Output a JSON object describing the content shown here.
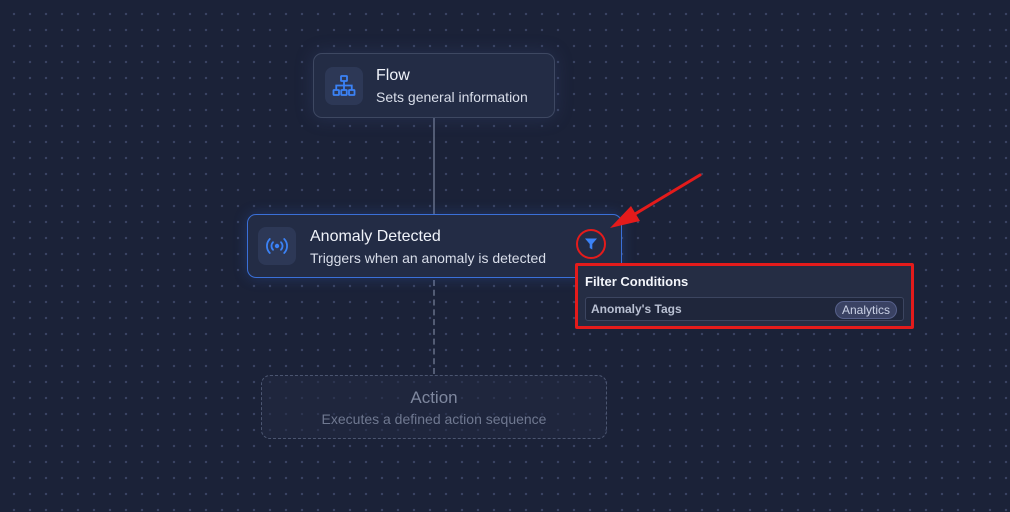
{
  "canvas": {
    "background": "#1b2238",
    "accent": "#3a70d8",
    "highlight": "#e41b1b"
  },
  "nodes": {
    "flow": {
      "title": "Flow",
      "subtitle": "Sets general information",
      "icon": "sitemap-icon"
    },
    "trigger": {
      "title": "Anomaly Detected",
      "subtitle": "Triggers when an anomaly is detected",
      "icon": "broadcast-icon"
    },
    "action": {
      "title": "Action",
      "subtitle": "Executes a defined action sequence"
    }
  },
  "filter": {
    "button_icon": "filter-icon",
    "popup_title": "Filter Conditions",
    "conditions": [
      {
        "key": "Anomaly's Tags",
        "value": "Analytics"
      }
    ]
  }
}
